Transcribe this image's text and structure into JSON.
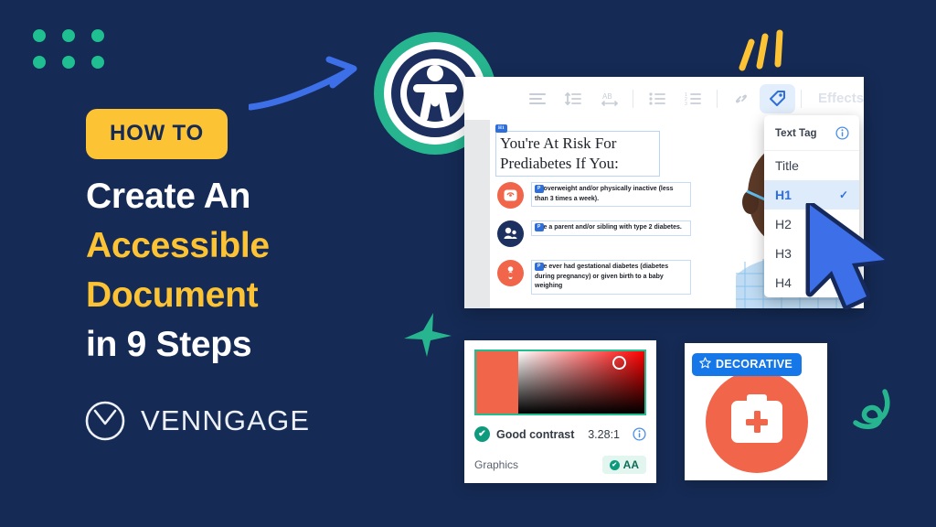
{
  "background_color": "#152A54",
  "accent_yellow": "#FCC435",
  "accent_teal": "#1FBF92",
  "accent_blue": "#2F6FDB",
  "accent_orange": "#F1654A",
  "hero": {
    "badge_label": "HOW TO",
    "title_line_1": "Create An",
    "title_line_2": "Accessible",
    "title_line_3": "Document",
    "title_line_4": "in 9 Steps"
  },
  "logo": {
    "wordmark": "VENNGAGE",
    "mark_icon": "venn-circle-icon"
  },
  "decorations": {
    "dots_icon": "dot-grid-icon",
    "arrow_icon": "curved-arrow-icon",
    "strokes_icon": "yellow-strokes-icon",
    "star_icon": "teal-star-icon",
    "swirl_icon": "teal-swirl-icon",
    "accessibility_icon": "accessibility-person-icon"
  },
  "editor": {
    "toolbar": {
      "items": [
        {
          "icon": "text-align-icon",
          "label": "Align",
          "active": false
        },
        {
          "icon": "line-height-icon",
          "label": "Line height",
          "active": false
        },
        {
          "icon": "letter-spacing-icon",
          "label": "Letter spacing",
          "active": false
        },
        {
          "icon": "bullet-list-icon",
          "label": "Bullet list",
          "active": false
        },
        {
          "icon": "numbered-list-icon",
          "label": "Numbered list",
          "active": false
        },
        {
          "icon": "link-icon",
          "label": "Link",
          "active": false
        },
        {
          "icon": "tag-icon",
          "label": "Text tag",
          "active": true
        }
      ],
      "effects_label": "Effects"
    },
    "document": {
      "title": "You're At Risk For Prediabetes If You:",
      "title_tag": "H1",
      "items": [
        {
          "tag": "P",
          "text": "overweight and/or physically inactive (less than 3 times a week).",
          "icon": "scale-icon",
          "icon_color": "orange"
        },
        {
          "tag": "P",
          "text": "e a parent and/or sibling with type 2 diabetes.",
          "icon": "family-icon",
          "icon_color": "navy"
        },
        {
          "tag": "P",
          "text": "e ever had gestational diabetes (diabetes during pregnancy) or given birth to a baby weighing",
          "icon": "pregnancy-icon",
          "icon_color": "orange"
        }
      ]
    }
  },
  "dropdown": {
    "header_label": "Text Tag",
    "info_icon": "info-icon",
    "options": [
      {
        "label": "Title",
        "selected": false
      },
      {
        "label": "H1",
        "selected": true
      },
      {
        "label": "H2",
        "selected": false
      },
      {
        "label": "H3",
        "selected": false
      },
      {
        "label": "H4",
        "selected": false
      }
    ],
    "check_glyph": "✓"
  },
  "cursor": {
    "icon": "mouse-pointer-icon"
  },
  "contrast_card": {
    "picker_icon": "color-picker-gradient",
    "status_icon": "check-circle-icon",
    "status_label": "Good contrast",
    "ratio": "3.28:1",
    "info_icon": "info-icon",
    "category_label": "Graphics",
    "badge_label": "AA",
    "badge_icon": "check-circle-icon",
    "check_glyph": "✔"
  },
  "decorative_card": {
    "badge_label": "DECORATIVE",
    "badge_icon": "star-outline-icon",
    "graphic_icon": "medical-kit-icon"
  }
}
